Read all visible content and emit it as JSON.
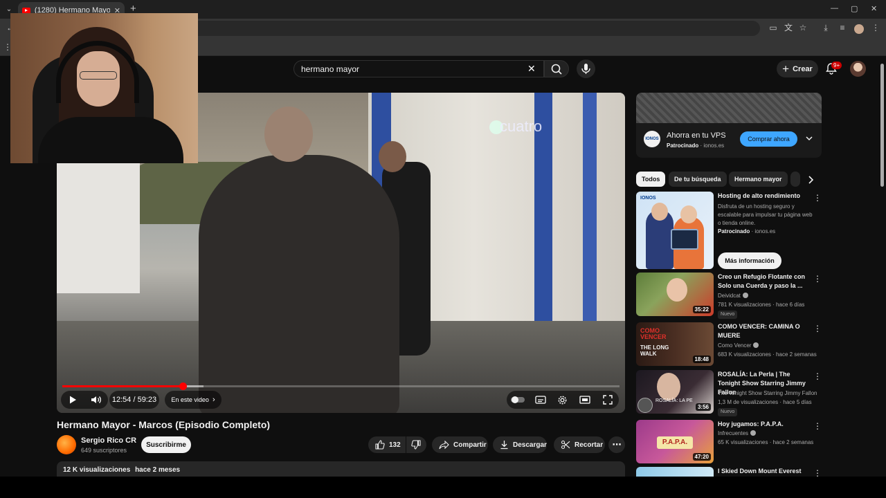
{
  "browser": {
    "tab_title": "(1280) Hermano Mayor - Marcos",
    "new_tab": "+",
    "tab_close": "✕"
  },
  "youtube": {
    "search_query": "hermano mayor",
    "create_label": "Crear",
    "notif_badge": "9+"
  },
  "player": {
    "watermark": "cuatro",
    "time": "12:54 / 59:23",
    "chapters_label": "En este video",
    "progress": 0.2173,
    "buffered": 0.2531
  },
  "video": {
    "title": "Hermano Mayor - Marcos (Episodio Completo)",
    "channel": "Sergio Rico CR",
    "subscribers": "649 suscriptores",
    "subscribe_label": "Suscribirme",
    "likes": "132",
    "share_label": "Compartir",
    "download_label": "Descargar",
    "clip_label": "Recortar",
    "views": "12 K visualizaciones",
    "age": "hace 2 meses"
  },
  "ad": {
    "title": "Ahorra en tu VPS",
    "sponsored": "Patrocinado",
    "domain": "ionos.es",
    "button": "Comprar ahora",
    "logo_text": "IONOS"
  },
  "chips": [
    "Todos",
    "De tu búsqueda",
    "Hermano mayor"
  ],
  "sponsored_card": {
    "title": "Hosting de alto rendimiento",
    "description": "Disfruta de un hosting seguro y escalable para impulsar tu página web o tienda online.",
    "sponsored": "Patrocinado",
    "domain": "ionos.es",
    "button": "Más información",
    "thumb_text": "IONOS"
  },
  "related": [
    {
      "title": "Creo un Refugio Flotante con Solo una Cuerda y paso la ...",
      "channel": "Deividcat",
      "meta": "781 K visualizaciones · hace 6 días",
      "badge": "Nuevo",
      "duration": "35:22"
    },
    {
      "title": "COMO VENCER: CAMINA O MUERE",
      "channel": "Como Vencer",
      "meta": "683 K visualizaciones · hace 2 semanas",
      "badge": "",
      "duration": "18:48",
      "thumb_text": "COMO VENCER",
      "thumb_sub": "THE LONG WALK"
    },
    {
      "title": "ROSALÍA: La Perla | The Tonight Show Starring Jimmy Fallon",
      "channel": "The Tonight Show Starring Jimmy Fallon",
      "meta": "1,3 M de visualizaciones · hace 5 días",
      "badge": "Nuevo",
      "duration": "3:56",
      "thumb_text": "ROSALÍA: LA PE"
    },
    {
      "title": "Hoy jugamos: P.A.P.A.",
      "channel": "Infrecuentes",
      "meta": "65 K visualizaciones · hace 2 semanas",
      "badge": "",
      "duration": "47:20",
      "thumb_text": "P.A.P.A."
    },
    {
      "title": "I Skied Down Mount Everest",
      "channel": "",
      "meta": "",
      "badge": "",
      "duration": ""
    }
  ]
}
